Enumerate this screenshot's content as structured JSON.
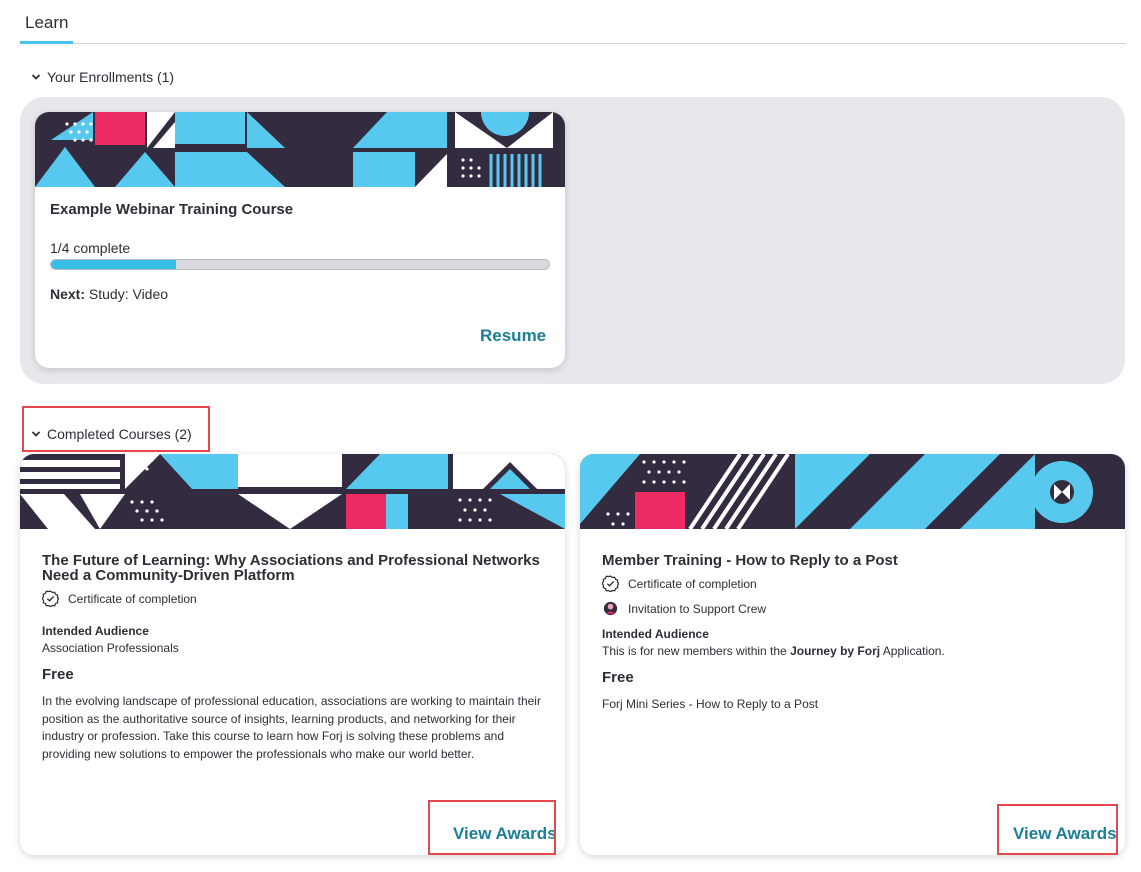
{
  "tabs": [
    {
      "label": "Learn",
      "active": true
    }
  ],
  "sections": {
    "enrollments": {
      "label": "Your Enrollments (1)"
    },
    "completed": {
      "label": "Completed Courses (2)"
    }
  },
  "enrollment_card": {
    "title": "Example Webinar Training Course",
    "progress_text": "1/4 complete",
    "progress_fraction": 0.25,
    "next_label": "Next:",
    "next_value": "Study: Video",
    "resume_label": "Resume"
  },
  "completed_cards": [
    {
      "title": "The Future of Learning: Why Associations and Professional Networks Need a Community-Driven Platform",
      "awards": [
        {
          "icon": "check-badge-icon",
          "label": "Certificate of completion"
        }
      ],
      "audience_label": "Intended Audience",
      "audience_text": "Association Professionals",
      "price": "Free",
      "description": "In the evolving landscape of professional education, associations are working to maintain their position as the authoritative source of insights, learning products, and networking for their industry or profession. Take this course to learn how Forj is solving these problems and providing new solutions to empower the professionals who make our world better.",
      "action_label": "View Awards"
    },
    {
      "title": "Member Training - How to Reply to a Post",
      "awards": [
        {
          "icon": "check-badge-icon",
          "label": "Certificate of completion"
        },
        {
          "icon": "support-crew-badge-icon",
          "label": "Invitation to Support Crew"
        }
      ],
      "audience_label": "Intended Audience",
      "audience_prefix": "This is for new members within the ",
      "audience_bold": "Journey by Forj",
      "audience_suffix": " Application.",
      "price": "Free",
      "description": "Forj Mini Series - How to Reply to a Post",
      "action_label": "View Awards"
    }
  ],
  "colors": {
    "accent_blue": "#58c9ee",
    "dark_navy": "#332b3f",
    "pink": "#ee2a62",
    "link_teal": "#1b7f96",
    "highlight_red": "#e5474c"
  }
}
